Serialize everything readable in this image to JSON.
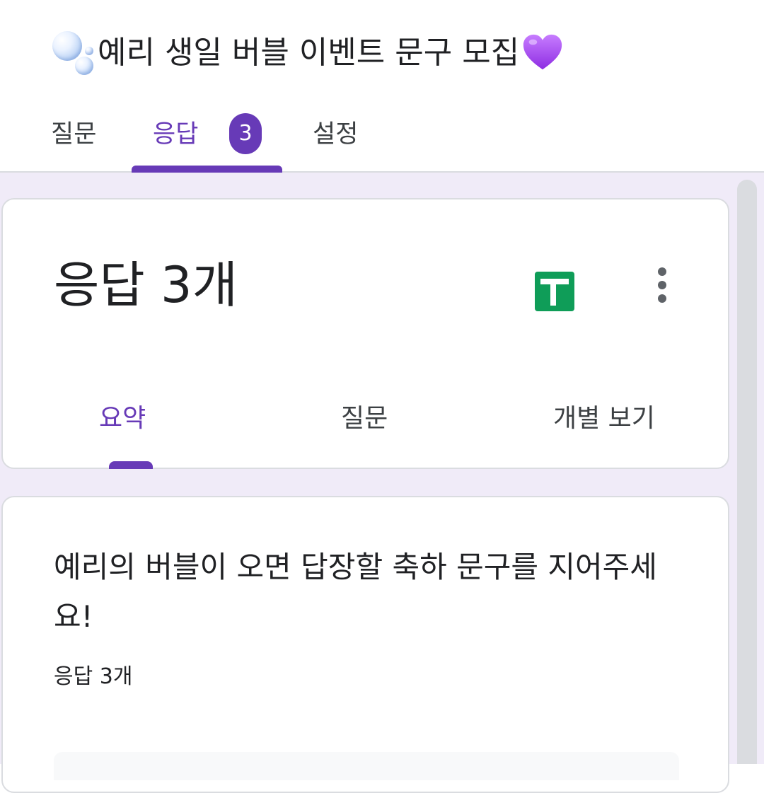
{
  "form": {
    "title": "예리 생일 버블 이벤트 문구 모집",
    "title_prefix_icon": "bubbles-icon",
    "title_suffix_icon": "purple-heart-icon"
  },
  "top_tabs": [
    {
      "label": "질문",
      "active": false
    },
    {
      "label": "응답",
      "active": true,
      "badge": "3"
    },
    {
      "label": "설정",
      "active": false
    }
  ],
  "summary": {
    "heading": "응답 3개",
    "sheets_icon": "google-sheets-icon",
    "more_icon": "more-vert-icon",
    "tabs": [
      {
        "label": "요약",
        "active": true
      },
      {
        "label": "질문",
        "active": false
      },
      {
        "label": "개별 보기",
        "active": false
      }
    ]
  },
  "question": {
    "text": "예리의 버블이 오면 답장할 축하 문구를 지어주세요!",
    "response_count": "응답 3개"
  },
  "colors": {
    "accent": "#673ab7",
    "background": "#f0ebf8",
    "sheets_green": "#0f9d58"
  }
}
